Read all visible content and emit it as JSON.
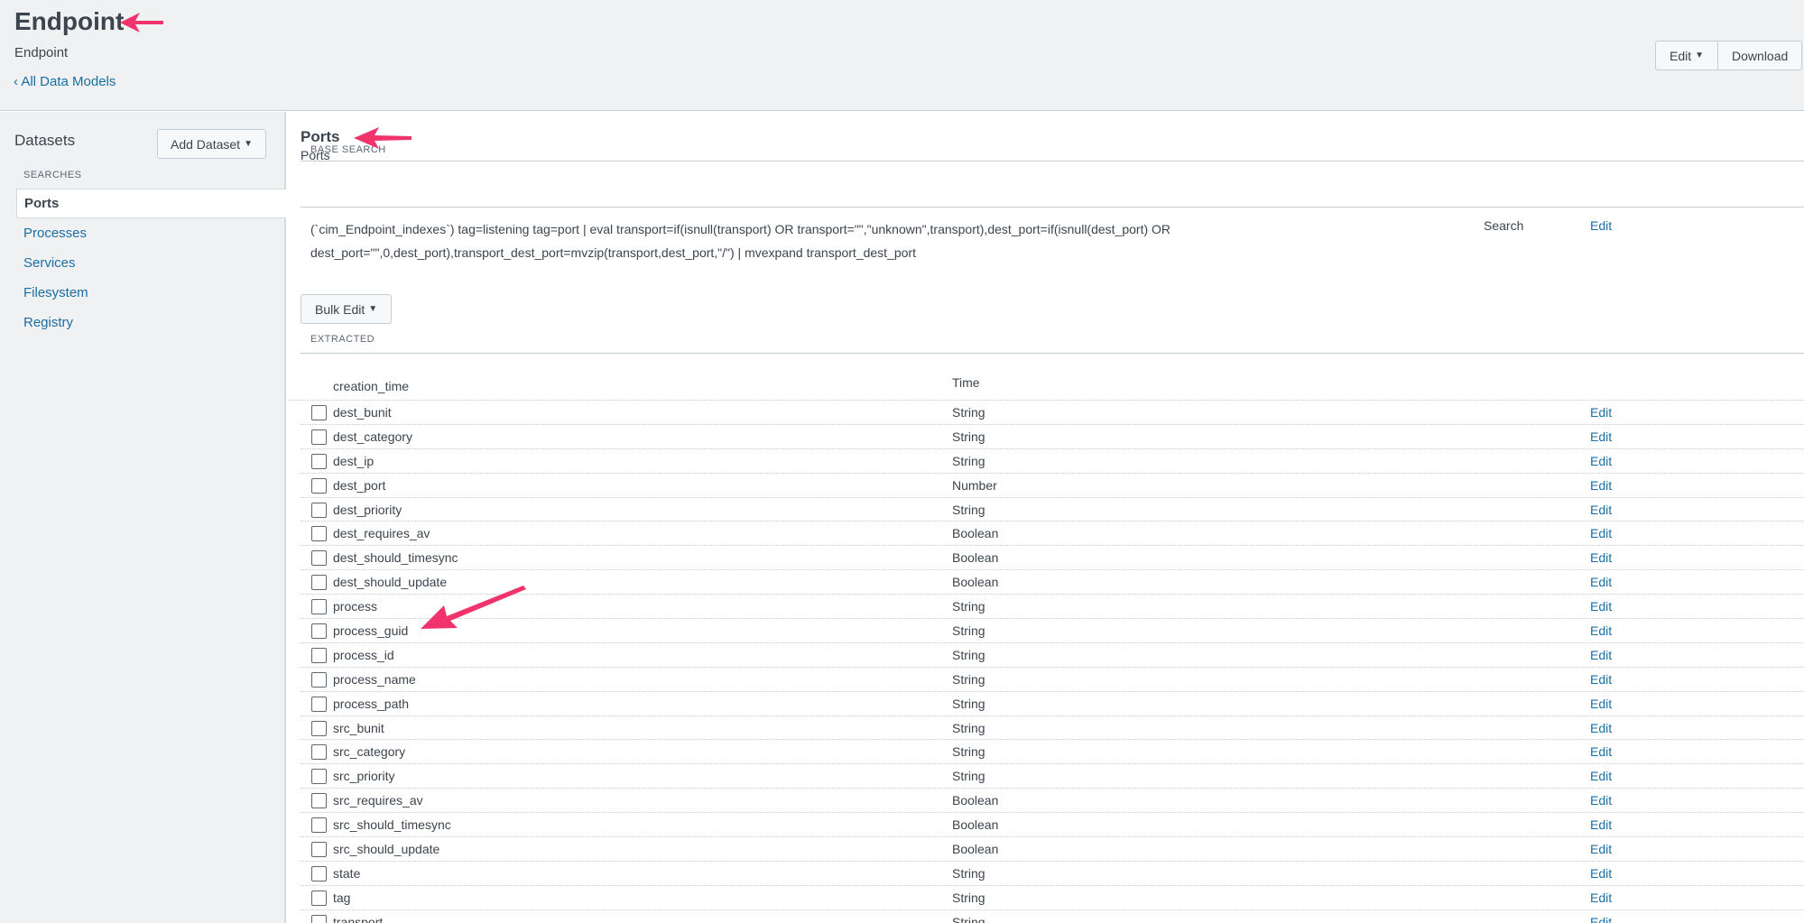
{
  "header": {
    "title": "Endpoint",
    "subtitle": "Endpoint",
    "back_link": "All Data Models",
    "edit_label": "Edit",
    "download_label": "Download"
  },
  "sidebar": {
    "title": "Datasets",
    "add_dataset_label": "Add Dataset",
    "section_label": "SEARCHES",
    "items": [
      {
        "label": "Ports",
        "active": true
      },
      {
        "label": "Processes",
        "active": false
      },
      {
        "label": "Services",
        "active": false
      },
      {
        "label": "Filesystem",
        "active": false
      },
      {
        "label": "Registry",
        "active": false
      }
    ]
  },
  "dataset": {
    "title": "Ports",
    "subtitle": "Ports",
    "base_search_label": "BASE SEARCH",
    "base_search_line1": "(`cim_Endpoint_indexes`) tag=listening tag=port | eval transport=if(isnull(transport) OR transport=\"\",\"unknown\",transport),dest_port=if(isnull(dest_port) OR",
    "base_search_line2": "dest_port=\"\",0,dest_port),transport_dest_port=mvzip(transport,dest_port,\"/\") | mvexpand transport_dest_port",
    "base_search_type": "Search",
    "base_search_edit": "Edit",
    "bulk_edit_label": "Bulk Edit",
    "extracted_label": "EXTRACTED",
    "time_field": {
      "name": "creation_time",
      "type": "Time"
    },
    "fields": [
      {
        "name": "dest_bunit",
        "type": "String",
        "edit": "Edit"
      },
      {
        "name": "dest_category",
        "type": "String",
        "edit": "Edit"
      },
      {
        "name": "dest_ip",
        "type": "String",
        "edit": "Edit"
      },
      {
        "name": "dest_port",
        "type": "Number",
        "edit": "Edit"
      },
      {
        "name": "dest_priority",
        "type": "String",
        "edit": "Edit"
      },
      {
        "name": "dest_requires_av",
        "type": "Boolean",
        "edit": "Edit"
      },
      {
        "name": "dest_should_timesync",
        "type": "Boolean",
        "edit": "Edit"
      },
      {
        "name": "dest_should_update",
        "type": "Boolean",
        "edit": "Edit"
      },
      {
        "name": "process",
        "type": "String",
        "edit": "Edit"
      },
      {
        "name": "process_guid",
        "type": "String",
        "edit": "Edit"
      },
      {
        "name": "process_id",
        "type": "String",
        "edit": "Edit"
      },
      {
        "name": "process_name",
        "type": "String",
        "edit": "Edit"
      },
      {
        "name": "process_path",
        "type": "String",
        "edit": "Edit"
      },
      {
        "name": "src_bunit",
        "type": "String",
        "edit": "Edit"
      },
      {
        "name": "src_category",
        "type": "String",
        "edit": "Edit"
      },
      {
        "name": "src_priority",
        "type": "String",
        "edit": "Edit"
      },
      {
        "name": "src_requires_av",
        "type": "Boolean",
        "edit": "Edit"
      },
      {
        "name": "src_should_timesync",
        "type": "Boolean",
        "edit": "Edit"
      },
      {
        "name": "src_should_update",
        "type": "Boolean",
        "edit": "Edit"
      },
      {
        "name": "state",
        "type": "String",
        "edit": "Edit"
      },
      {
        "name": "tag",
        "type": "String",
        "edit": "Edit"
      },
      {
        "name": "transport",
        "type": "String",
        "edit": "Edit"
      }
    ]
  },
  "colors": {
    "link": "#1a6ea3",
    "annotation_arrow": "#f0346b",
    "header_bg": "#eff1f2"
  }
}
